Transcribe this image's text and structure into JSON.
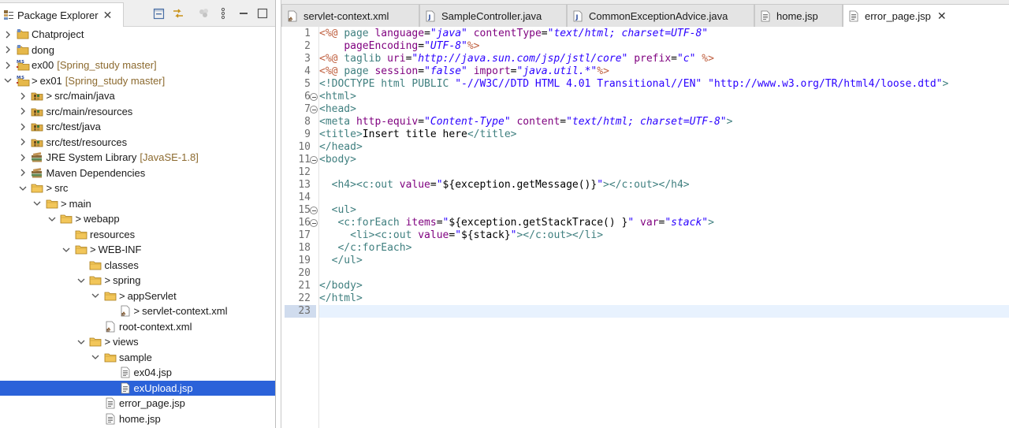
{
  "package_explorer": {
    "title": "Package Explorer",
    "tree": [
      {
        "label": "Chatproject",
        "decor": "",
        "prefix": "",
        "level": 0,
        "twisty": "collapsed",
        "icon": "project-folder-icon"
      },
      {
        "label": "dong",
        "decor": "",
        "prefix": "",
        "level": 0,
        "twisty": "collapsed",
        "icon": "project-folder-icon"
      },
      {
        "label": "ex00",
        "decor": "[Spring_study master]",
        "prefix": "",
        "level": 0,
        "twisty": "collapsed",
        "icon": "maven-project-icon"
      },
      {
        "label": "ex01",
        "decor": "[Spring_study master]",
        "prefix": ">",
        "level": 0,
        "twisty": "expanded",
        "icon": "maven-project-icon"
      },
      {
        "label": "src/main/java",
        "decor": "",
        "prefix": ">",
        "level": 1,
        "twisty": "collapsed",
        "icon": "source-folder-icon"
      },
      {
        "label": "src/main/resources",
        "decor": "",
        "prefix": "",
        "level": 1,
        "twisty": "collapsed",
        "icon": "source-folder-icon"
      },
      {
        "label": "src/test/java",
        "decor": "",
        "prefix": "",
        "level": 1,
        "twisty": "collapsed",
        "icon": "source-folder-icon"
      },
      {
        "label": "src/test/resources",
        "decor": "",
        "prefix": "",
        "level": 1,
        "twisty": "collapsed",
        "icon": "source-folder-icon"
      },
      {
        "label": "JRE System Library",
        "decor": "[JavaSE-1.8]",
        "prefix": "",
        "level": 1,
        "twisty": "collapsed",
        "icon": "library-icon"
      },
      {
        "label": "Maven Dependencies",
        "decor": "",
        "prefix": "",
        "level": 1,
        "twisty": "collapsed",
        "icon": "library-icon"
      },
      {
        "label": "src",
        "decor": "",
        "prefix": ">",
        "level": 1,
        "twisty": "expanded",
        "icon": "folder-icon"
      },
      {
        "label": "main",
        "decor": "",
        "prefix": ">",
        "level": 2,
        "twisty": "expanded",
        "icon": "folder-icon"
      },
      {
        "label": "webapp",
        "decor": "",
        "prefix": ">",
        "level": 3,
        "twisty": "expanded",
        "icon": "folder-icon"
      },
      {
        "label": "resources",
        "decor": "",
        "prefix": "",
        "level": 4,
        "twisty": "none",
        "icon": "folder-icon"
      },
      {
        "label": "WEB-INF",
        "decor": "",
        "prefix": ">",
        "level": 4,
        "twisty": "expanded",
        "icon": "folder-icon"
      },
      {
        "label": "classes",
        "decor": "",
        "prefix": "",
        "level": 5,
        "twisty": "none",
        "icon": "folder-icon"
      },
      {
        "label": "spring",
        "decor": "",
        "prefix": ">",
        "level": 5,
        "twisty": "expanded",
        "icon": "folder-icon"
      },
      {
        "label": "appServlet",
        "decor": "",
        "prefix": ">",
        "level": 6,
        "twisty": "expanded",
        "icon": "folder-icon"
      },
      {
        "label": "servlet-context.xml",
        "decor": "",
        "prefix": ">",
        "level": 7,
        "twisty": "none",
        "icon": "xml-file-icon"
      },
      {
        "label": "root-context.xml",
        "decor": "",
        "prefix": "",
        "level": 6,
        "twisty": "none",
        "icon": "xml-file-icon"
      },
      {
        "label": "views",
        "decor": "",
        "prefix": ">",
        "level": 5,
        "twisty": "expanded",
        "icon": "folder-icon"
      },
      {
        "label": "sample",
        "decor": "",
        "prefix": "",
        "level": 6,
        "twisty": "expanded",
        "icon": "folder-icon"
      },
      {
        "label": "ex04.jsp",
        "decor": "",
        "prefix": "",
        "level": 7,
        "twisty": "none",
        "icon": "jsp-file-icon"
      },
      {
        "label": "exUpload.jsp",
        "decor": "",
        "prefix": "",
        "level": 7,
        "twisty": "none",
        "icon": "jsp-file-icon",
        "selected": true
      },
      {
        "label": "error_page.jsp",
        "decor": "",
        "prefix": "",
        "level": 6,
        "twisty": "none",
        "icon": "jsp-file-icon"
      },
      {
        "label": "home.jsp",
        "decor": "",
        "prefix": "",
        "level": 6,
        "twisty": "none",
        "icon": "jsp-file-icon"
      }
    ]
  },
  "editor_tabs": [
    {
      "label": "servlet-context.xml",
      "icon": "xml-file-icon",
      "active": false
    },
    {
      "label": "SampleController.java",
      "icon": "java-file-icon",
      "active": false
    },
    {
      "label": "CommonExceptionAdvice.java",
      "icon": "java-file-icon",
      "active": false
    },
    {
      "label": "home.jsp",
      "icon": "jsp-file-icon",
      "active": false
    },
    {
      "label": "error_page.jsp",
      "icon": "jsp-file-icon",
      "active": true
    }
  ],
  "editor": {
    "current_line": 23,
    "fold_lines": [
      6,
      7,
      11,
      15,
      16
    ],
    "lines": [
      [
        [
          "dir",
          "<%@ "
        ],
        [
          "kw",
          "page "
        ],
        [
          "attr",
          "language"
        ],
        [
          "txt",
          "="
        ],
        [
          "str",
          "\"java\""
        ],
        [
          "txt",
          " "
        ],
        [
          "attr",
          "contentType"
        ],
        [
          "txt",
          "="
        ],
        [
          "str",
          "\"text/html; charset=UTF-8\""
        ]
      ],
      [
        [
          "txt",
          "    "
        ],
        [
          "attr",
          "pageEncoding"
        ],
        [
          "txt",
          "="
        ],
        [
          "str",
          "\"UTF-8\""
        ],
        [
          "dir",
          "%>"
        ]
      ],
      [
        [
          "dir",
          "<%@ "
        ],
        [
          "kw",
          "taglib "
        ],
        [
          "attr",
          "uri"
        ],
        [
          "txt",
          "="
        ],
        [
          "str",
          "\"http://java.sun.com/jsp/jstl/core\""
        ],
        [
          "txt",
          " "
        ],
        [
          "attr",
          "prefix"
        ],
        [
          "txt",
          "="
        ],
        [
          "str",
          "\"c\""
        ],
        [
          "txt",
          " "
        ],
        [
          "dir",
          "%>"
        ]
      ],
      [
        [
          "dir",
          "<%@ "
        ],
        [
          "kw",
          "page "
        ],
        [
          "attr",
          "session"
        ],
        [
          "txt",
          "="
        ],
        [
          "str",
          "\"false\""
        ],
        [
          "txt",
          " "
        ],
        [
          "attr",
          "import"
        ],
        [
          "txt",
          "="
        ],
        [
          "str",
          "\"java.util.*\""
        ],
        [
          "dir",
          "%>"
        ]
      ],
      [
        [
          "doc",
          "<!DOCTYPE html PUBLIC "
        ],
        [
          "docstr",
          "\"-//W3C//DTD HTML 4.01 Transitional//EN\""
        ],
        [
          "doc",
          " "
        ],
        [
          "docstr",
          "\"http://www.w3.org/TR/html4/loose.dtd\""
        ],
        [
          "doc",
          ">"
        ]
      ],
      [
        [
          "tag",
          "<html>"
        ]
      ],
      [
        [
          "tag",
          "<head>"
        ]
      ],
      [
        [
          "tag",
          "<meta "
        ],
        [
          "attr",
          "http-equiv"
        ],
        [
          "txt",
          "="
        ],
        [
          "str",
          "\"Content-Type\""
        ],
        [
          "txt",
          " "
        ],
        [
          "attr",
          "content"
        ],
        [
          "txt",
          "="
        ],
        [
          "str",
          "\"text/html; charset=UTF-8\""
        ],
        [
          "tag",
          ">"
        ]
      ],
      [
        [
          "tag",
          "<title>"
        ],
        [
          "txt",
          "Insert title here"
        ],
        [
          "tag",
          "</title>"
        ]
      ],
      [
        [
          "tag",
          "</head>"
        ]
      ],
      [
        [
          "tag",
          "<body>"
        ]
      ],
      [],
      [
        [
          "txt",
          "  "
        ],
        [
          "tag",
          "<h4><c:out "
        ],
        [
          "attr",
          "value"
        ],
        [
          "txt",
          "="
        ],
        [
          "strn",
          "\""
        ],
        [
          "txt",
          "${exception.getMessage()}"
        ],
        [
          "strn",
          "\""
        ],
        [
          "tag",
          "></c:out></h4>"
        ]
      ],
      [],
      [
        [
          "txt",
          "  "
        ],
        [
          "tag",
          "<ul>"
        ]
      ],
      [
        [
          "txt",
          "   "
        ],
        [
          "tag",
          "<c:forEach "
        ],
        [
          "attr",
          "items"
        ],
        [
          "txt",
          "="
        ],
        [
          "strn",
          "\""
        ],
        [
          "txt",
          "${exception.getStackTrace() }"
        ],
        [
          "strn",
          "\""
        ],
        [
          "txt",
          " "
        ],
        [
          "attr",
          "var"
        ],
        [
          "txt",
          "="
        ],
        [
          "str",
          "\"stack\""
        ],
        [
          "tag",
          ">"
        ]
      ],
      [
        [
          "txt",
          "     "
        ],
        [
          "tag",
          "<li><c:out "
        ],
        [
          "attr",
          "value"
        ],
        [
          "txt",
          "="
        ],
        [
          "strn",
          "\""
        ],
        [
          "txt",
          "${stack}"
        ],
        [
          "strn",
          "\""
        ],
        [
          "tag",
          "></c:out></li>"
        ]
      ],
      [
        [
          "txt",
          "   "
        ],
        [
          "tag",
          "</c:forEach>"
        ]
      ],
      [
        [
          "txt",
          "  "
        ],
        [
          "tag",
          "</ul>"
        ]
      ],
      [],
      [
        [
          "tag",
          "</body>"
        ]
      ],
      [
        [
          "tag",
          "</html>"
        ]
      ],
      []
    ]
  },
  "colors": {
    "selection": "#2b62d9",
    "current_line": "#e8f2fe",
    "directive": "#bf5f3f",
    "tag": "#3f7f7f",
    "attribute": "#7f007f",
    "string": "#2a00ff",
    "decorator": "#8c6a2f"
  }
}
